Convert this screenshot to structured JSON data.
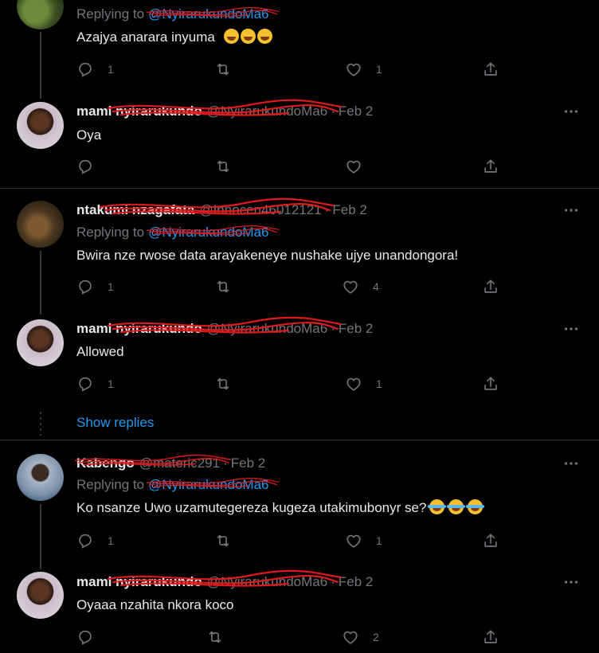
{
  "reply_prefix": "Replying to",
  "show_replies": "Show replies",
  "tweets": [
    {
      "replying_to": "@NyirarukundoMa6",
      "text": "Azajya anarara inyuma",
      "emoji": [
        "weary-face",
        "weary-face",
        "weary-face"
      ],
      "reply_count": "1",
      "like_count": "1"
    },
    {
      "name": "mami nyirarukundo",
      "handle": "@NyirarukundoMa6",
      "date": "Feb 2",
      "text": "Oya",
      "reply_count": "",
      "like_count": ""
    },
    {
      "name": "ntakumi nzagafata",
      "handle": "@Innocen46012121",
      "date": "Feb 2",
      "replying_to": "@NyirarukundoMa6",
      "text": "Bwira nze rwose data arayakeneye nushake ujye unandongora!",
      "reply_count": "1",
      "like_count": "4"
    },
    {
      "name": "mami nyirarukundo",
      "handle": "@NyirarukundoMa6",
      "date": "Feb 2",
      "text": "Allowed",
      "reply_count": "1",
      "like_count": "1"
    },
    {
      "name": "Kabengo",
      "handle": "@materic291",
      "date": "Feb 2",
      "replying_to": "@NyirarukundoMa6",
      "text": "Ko nsanze Uwo uzamutegereza kugeza utakimubonyr se?",
      "emoji": [
        "face-with-tears-of-joy",
        "face-with-tears-of-joy",
        "face-with-tears-of-joy"
      ],
      "reply_count": "1",
      "like_count": "1"
    },
    {
      "name": "mami nyirarukundo",
      "handle": "@NyirarukundoMa6",
      "date": "Feb 2",
      "text": "Oyaaa nzahita nkora koco",
      "reply_count": "",
      "like_count": "2"
    }
  ],
  "colors": {
    "background": "#000000",
    "text": "#e7e9ea",
    "muted": "#71767b",
    "accent": "#1d9bf0",
    "redaction": "#e0191c"
  }
}
